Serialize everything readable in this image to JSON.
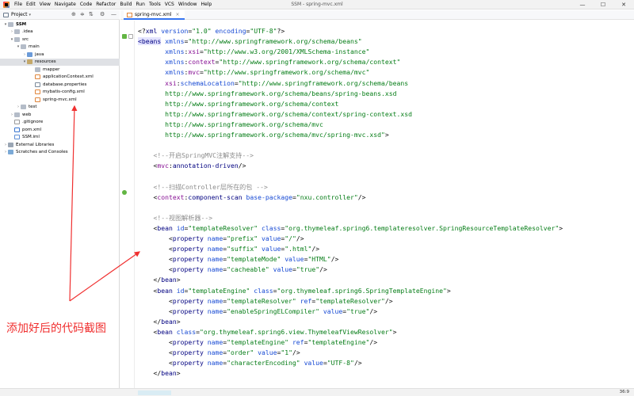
{
  "app": {
    "window_title": "SSM - spring-mvc.xml",
    "menu": [
      "File",
      "Edit",
      "View",
      "Navigate",
      "Code",
      "Refactor",
      "Build",
      "Run",
      "Tools",
      "VCS",
      "Window",
      "Help"
    ],
    "window_controls": {
      "minimize": "—",
      "maximize": "☐",
      "close": "✕"
    }
  },
  "project_panel": {
    "title": "Project",
    "title_chevron": "▾",
    "tools": [
      "⊕",
      "≑",
      "⇅",
      "⚙",
      "—"
    ],
    "tree": [
      {
        "label": "SSM",
        "chevron": "▾",
        "icon": "folder"
      },
      {
        "label": ".idea",
        "chevron": "›",
        "icon": "folder"
      },
      {
        "label": "src",
        "chevron": "▾",
        "icon": "folder"
      },
      {
        "label": "main",
        "chevron": "▾",
        "icon": "folder"
      },
      {
        "label": "java",
        "chevron": "›",
        "icon": "folder-blue"
      },
      {
        "label": "resources",
        "chevron": "▾",
        "icon": "folder-res"
      },
      {
        "label": "mapper",
        "chevron": "",
        "icon": "folder"
      },
      {
        "label": "applicationContext.xml",
        "chevron": "",
        "icon": "file-xml"
      },
      {
        "label": "database.properties",
        "chevron": "",
        "icon": "file-prop"
      },
      {
        "label": "mybatis-config.xml",
        "chevron": "",
        "icon": "file-xml"
      },
      {
        "label": "spring-mvc.xml",
        "chevron": "",
        "icon": "file-xml"
      },
      {
        "label": "test",
        "chevron": "›",
        "icon": "folder"
      },
      {
        "label": "web",
        "chevron": "›",
        "icon": "folder"
      },
      {
        "label": ".gitignore",
        "chevron": "",
        "icon": "file-git"
      },
      {
        "label": "pom.xml",
        "chevron": "",
        "icon": "file-m"
      },
      {
        "label": "SSM.iml",
        "chevron": "",
        "icon": "file-iml"
      },
      {
        "label": "External Libraries",
        "chevron": "›",
        "icon": "lib"
      },
      {
        "label": "Scratches and Consoles",
        "chevron": "›",
        "icon": "scratch"
      }
    ]
  },
  "editor": {
    "tab_label": "spring-mvc.xml",
    "tab_close": "×",
    "lines": [
      [
        [
          "t-plain",
          "<?"
        ],
        [
          "t-tag",
          "xml "
        ],
        [
          "t-attr",
          "version"
        ],
        [
          "t-plain",
          "="
        ],
        [
          "t-val",
          "\"1.0\" "
        ],
        [
          "t-attr",
          "encoding"
        ],
        [
          "t-plain",
          "="
        ],
        [
          "t-val",
          "\"UTF-8\""
        ],
        [
          "t-plain",
          "?>"
        ]
      ],
      [
        [
          "t-tag t-beans-hl",
          "<beans"
        ],
        [
          "t-plain",
          " "
        ],
        [
          "t-attr",
          "xmlns"
        ],
        [
          "t-plain",
          "="
        ],
        [
          "t-val",
          "\"http://www.springframework.org/schema/beans\""
        ]
      ],
      [
        [
          "t-plain",
          "       "
        ],
        [
          "t-attr",
          "xmlns"
        ],
        [
          "t-plain",
          ":"
        ],
        [
          "t-ns",
          "xsi"
        ],
        [
          "t-plain",
          "="
        ],
        [
          "t-val",
          "\"http://www.w3.org/2001/XMLSchema-instance\""
        ]
      ],
      [
        [
          "t-plain",
          "       "
        ],
        [
          "t-attr",
          "xmlns"
        ],
        [
          "t-plain",
          ":"
        ],
        [
          "t-ns",
          "context"
        ],
        [
          "t-plain",
          "="
        ],
        [
          "t-val",
          "\"http://www.springframework.org/schema/context\""
        ]
      ],
      [
        [
          "t-plain",
          "       "
        ],
        [
          "t-attr",
          "xmlns"
        ],
        [
          "t-plain",
          ":"
        ],
        [
          "t-ns",
          "mvc"
        ],
        [
          "t-plain",
          "="
        ],
        [
          "t-val",
          "\"http://www.springframework.org/schema/mvc\""
        ]
      ],
      [
        [
          "t-plain",
          "       "
        ],
        [
          "t-ns",
          "xsi"
        ],
        [
          "t-plain",
          ":"
        ],
        [
          "t-attr",
          "schemaLocation"
        ],
        [
          "t-plain",
          "="
        ],
        [
          "t-val",
          "\"http://www.springframework.org/schema/beans"
        ]
      ],
      [
        [
          "t-val",
          "       http://www.springframework.org/schema/beans/spring-beans.xsd"
        ]
      ],
      [
        [
          "t-val",
          "       http://www.springframework.org/schema/context"
        ]
      ],
      [
        [
          "t-val",
          "       http://www.springframework.org/schema/context/spring-context.xsd"
        ]
      ],
      [
        [
          "t-val",
          "       http://www.springframework.org/schema/mvc"
        ]
      ],
      [
        [
          "t-val",
          "       http://www.springframework.org/schema/mvc/spring-mvc.xsd\""
        ],
        [
          "t-plain",
          ">"
        ]
      ],
      [],
      [
        [
          "t-com",
          "    <!--开启SpringMVC注解支持-->"
        ]
      ],
      [
        [
          "t-plain",
          "    <"
        ],
        [
          "t-ns",
          "mvc"
        ],
        [
          "t-plain",
          ":"
        ],
        [
          "t-tag",
          "annotation-driven"
        ],
        [
          "t-plain",
          "/>"
        ]
      ],
      [],
      [
        [
          "t-com",
          "    <!--扫描Controller层所在的包 -->"
        ]
      ],
      [
        [
          "t-plain",
          "    <"
        ],
        [
          "t-ns",
          "context"
        ],
        [
          "t-plain",
          ":"
        ],
        [
          "t-tag",
          "component-scan "
        ],
        [
          "t-attr",
          "base-package"
        ],
        [
          "t-plain",
          "="
        ],
        [
          "t-val",
          "\"nxu.controller\""
        ],
        [
          "t-plain",
          "/>"
        ]
      ],
      [],
      [
        [
          "t-com",
          "    <!--视图解析器-->"
        ]
      ],
      [
        [
          "t-plain",
          "    <"
        ],
        [
          "t-tag",
          "bean "
        ],
        [
          "t-attr",
          "id"
        ],
        [
          "t-plain",
          "="
        ],
        [
          "t-val",
          "\"templateResolver\" "
        ],
        [
          "t-attr",
          "class"
        ],
        [
          "t-plain",
          "="
        ],
        [
          "t-val",
          "\"org.thymeleaf.spring6.templateresolver.SpringResourceTemplateResolver\""
        ],
        [
          "t-plain",
          ">"
        ]
      ],
      [
        [
          "t-plain",
          "        <"
        ],
        [
          "t-tag",
          "property "
        ],
        [
          "t-attr",
          "name"
        ],
        [
          "t-plain",
          "="
        ],
        [
          "t-val",
          "\"prefix\" "
        ],
        [
          "t-attr",
          "value"
        ],
        [
          "t-plain",
          "="
        ],
        [
          "t-val",
          "\"/\""
        ],
        [
          "t-plain",
          "/>"
        ]
      ],
      [
        [
          "t-plain",
          "        <"
        ],
        [
          "t-tag",
          "property "
        ],
        [
          "t-attr",
          "name"
        ],
        [
          "t-plain",
          "="
        ],
        [
          "t-val",
          "\"suffix\" "
        ],
        [
          "t-attr",
          "value"
        ],
        [
          "t-plain",
          "="
        ],
        [
          "t-val",
          "\".html\""
        ],
        [
          "t-plain",
          "/>"
        ]
      ],
      [
        [
          "t-plain",
          "        <"
        ],
        [
          "t-tag",
          "property "
        ],
        [
          "t-attr",
          "name"
        ],
        [
          "t-plain",
          "="
        ],
        [
          "t-val",
          "\"templateMode\" "
        ],
        [
          "t-attr",
          "value"
        ],
        [
          "t-plain",
          "="
        ],
        [
          "t-val",
          "\"HTML\""
        ],
        [
          "t-plain",
          "/>"
        ]
      ],
      [
        [
          "t-plain",
          "        <"
        ],
        [
          "t-tag",
          "property "
        ],
        [
          "t-attr",
          "name"
        ],
        [
          "t-plain",
          "="
        ],
        [
          "t-val",
          "\"cacheable\" "
        ],
        [
          "t-attr",
          "value"
        ],
        [
          "t-plain",
          "="
        ],
        [
          "t-val",
          "\"true\""
        ],
        [
          "t-plain",
          "/>"
        ]
      ],
      [
        [
          "t-plain",
          "    </"
        ],
        [
          "t-tag",
          "bean"
        ],
        [
          "t-plain",
          ">"
        ]
      ],
      [
        [
          "t-plain",
          "    <"
        ],
        [
          "t-tag",
          "bean "
        ],
        [
          "t-attr",
          "id"
        ],
        [
          "t-plain",
          "="
        ],
        [
          "t-val",
          "\"templateEngine\" "
        ],
        [
          "t-attr",
          "class"
        ],
        [
          "t-plain",
          "="
        ],
        [
          "t-val",
          "\"org.thymeleaf.spring6.SpringTemplateEngine\""
        ],
        [
          "t-plain",
          ">"
        ]
      ],
      [
        [
          "t-plain",
          "        <"
        ],
        [
          "t-tag",
          "property "
        ],
        [
          "t-attr",
          "name"
        ],
        [
          "t-plain",
          "="
        ],
        [
          "t-val",
          "\"templateResolver\" "
        ],
        [
          "t-attr",
          "ref"
        ],
        [
          "t-plain",
          "="
        ],
        [
          "t-val",
          "\"templateResolver\""
        ],
        [
          "t-plain",
          "/>"
        ]
      ],
      [
        [
          "t-plain",
          "        <"
        ],
        [
          "t-tag",
          "property "
        ],
        [
          "t-attr",
          "name"
        ],
        [
          "t-plain",
          "="
        ],
        [
          "t-val",
          "\"enableSpringELCompiler\" "
        ],
        [
          "t-attr",
          "value"
        ],
        [
          "t-plain",
          "="
        ],
        [
          "t-val",
          "\"true\""
        ],
        [
          "t-plain",
          "/>"
        ]
      ],
      [
        [
          "t-plain",
          "    </"
        ],
        [
          "t-tag",
          "bean"
        ],
        [
          "t-plain",
          ">"
        ]
      ],
      [
        [
          "t-plain",
          "    <"
        ],
        [
          "t-tag",
          "bean "
        ],
        [
          "t-attr",
          "class"
        ],
        [
          "t-plain",
          "="
        ],
        [
          "t-val",
          "\"org.thymeleaf.spring6.view.ThymeleafViewResolver\""
        ],
        [
          "t-plain",
          ">"
        ]
      ],
      [
        [
          "t-plain",
          "        <"
        ],
        [
          "t-tag",
          "property "
        ],
        [
          "t-attr",
          "name"
        ],
        [
          "t-plain",
          "="
        ],
        [
          "t-val",
          "\"templateEngine\" "
        ],
        [
          "t-attr",
          "ref"
        ],
        [
          "t-plain",
          "="
        ],
        [
          "t-val",
          "\"templateEngine\""
        ],
        [
          "t-plain",
          "/>"
        ]
      ],
      [
        [
          "t-plain",
          "        <"
        ],
        [
          "t-tag",
          "property "
        ],
        [
          "t-attr",
          "name"
        ],
        [
          "t-plain",
          "="
        ],
        [
          "t-val",
          "\"order\" "
        ],
        [
          "t-attr",
          "value"
        ],
        [
          "t-plain",
          "="
        ],
        [
          "t-val",
          "\"1\""
        ],
        [
          "t-plain",
          "/>"
        ]
      ],
      [
        [
          "t-plain",
          "        <"
        ],
        [
          "t-tag",
          "property "
        ],
        [
          "t-attr",
          "name"
        ],
        [
          "t-plain",
          "="
        ],
        [
          "t-val",
          "\"characterEncoding\" "
        ],
        [
          "t-attr",
          "value"
        ],
        [
          "t-plain",
          "="
        ],
        [
          "t-val",
          "\"UTF-8\""
        ],
        [
          "t-plain",
          "/>"
        ]
      ],
      [
        [
          "t-plain",
          "    </"
        ],
        [
          "t-tag",
          "bean"
        ],
        [
          "t-plain",
          ">"
        ]
      ]
    ]
  },
  "annotation": {
    "text": "添加好后的代码截图",
    "color": "#f03030"
  },
  "status": {
    "position": "36:9"
  }
}
